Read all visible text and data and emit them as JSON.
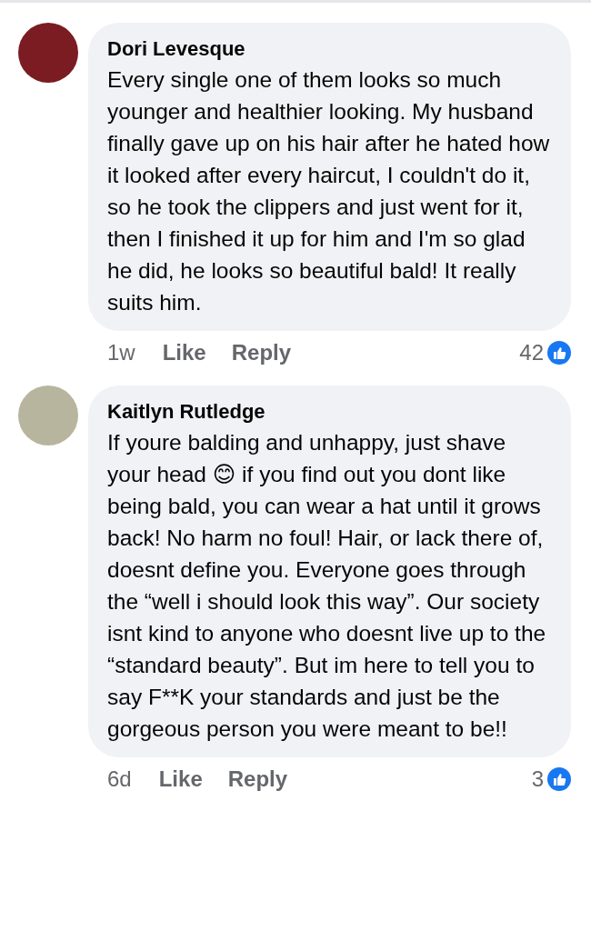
{
  "comments": [
    {
      "author": "Dori Levesque",
      "text": "Every single one of them looks so much younger and healthier looking. My husband finally gave up on his hair after he hated how it looked after every haircut, I couldn't do it, so he took the clippers and just went for it, then I finished it up for him and I'm so glad he did, he looks so beautiful bald! It really suits him.",
      "time": "1w",
      "like": "Like",
      "reply": "Reply",
      "reactions": "42"
    },
    {
      "author": "Kaitlyn Rutledge",
      "text": "If youre balding and unhappy, just shave your head 😊 if you find out you dont like being bald, you can wear a hat until it grows back! No harm no foul! Hair, or lack there of, doesnt define you. Everyone goes through the “well i should look this way”. Our society isnt kind to anyone who doesnt live up to the “standard beauty”. But im here to tell you to say F**K your standards and just be the gorgeous person you were meant to be!!",
      "time": "6d",
      "like": "Like",
      "reply": "Reply",
      "reactions": "3"
    }
  ]
}
